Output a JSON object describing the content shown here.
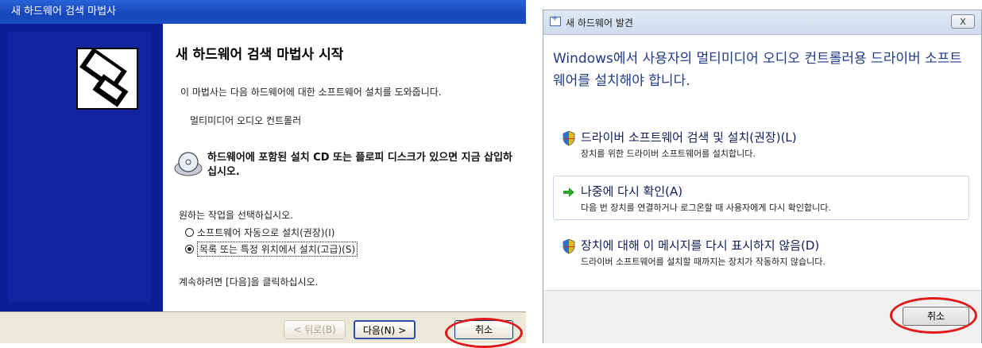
{
  "xp_wizard": {
    "title": "새 하드웨어 검색 마법사",
    "heading": "새 하드웨어 검색 마법사 시작",
    "description": "이 마법사는 다음 하드웨어에 대한 소프트웨어 설치를 도와줍니다.",
    "device_name": "멀티미디어 오디오 컨트롤러",
    "cd_instruction": "하드웨어에 포함된 설치 CD 또는 플로피 디스크가 있으면 지금 삽입하십시오.",
    "choose_prompt": "원하는 작업을 선택하십시오.",
    "options": [
      {
        "label": "소프트웨어 자동으로 설치(권장)(I)",
        "selected": false
      },
      {
        "label": "목록 또는 특정 위치에서 설치(고급)(S)",
        "selected": true
      }
    ],
    "continue_text": "계속하려면 [다음]을 클릭하십시오.",
    "buttons": {
      "back": "< 뒤로(B)",
      "next": "다음(N) >",
      "cancel": "취소"
    }
  },
  "vista_dialog": {
    "title": "새 하드웨어 발견",
    "close_label": "X",
    "heading": "Windows에서 사용자의 멀티미디어 오디오 컨트롤러용 드라이버 소프트웨어를 설치해야 합니다.",
    "options": [
      {
        "label": "드라이버 소프트웨어 검색 및 설치(권장)(L)",
        "description": "장치를 위한 드라이버 소프트웨어를 설치합니다.",
        "icon": "shield-icon"
      },
      {
        "label": "나중에 다시 확인(A)",
        "description": "다음 번 장치를 연결하거나 로그온할 때 사용자에게 다시 확인합니다.",
        "icon": "green-arrow-icon"
      },
      {
        "label": "장치에 대해 이 메시지를 다시 표시하지 않음(D)",
        "description": "드라이버 소프트웨어를 설치할 때까지는 장치가 작동하지 않습니다.",
        "icon": "shield-icon"
      }
    ],
    "cancel_label": "취소"
  },
  "colors": {
    "xp_title_bar": "#1f54c9",
    "xp_sidebar": "#0c1e96",
    "vista_heading": "#1f3a8a",
    "highlight_circle": "#e01a1a"
  }
}
